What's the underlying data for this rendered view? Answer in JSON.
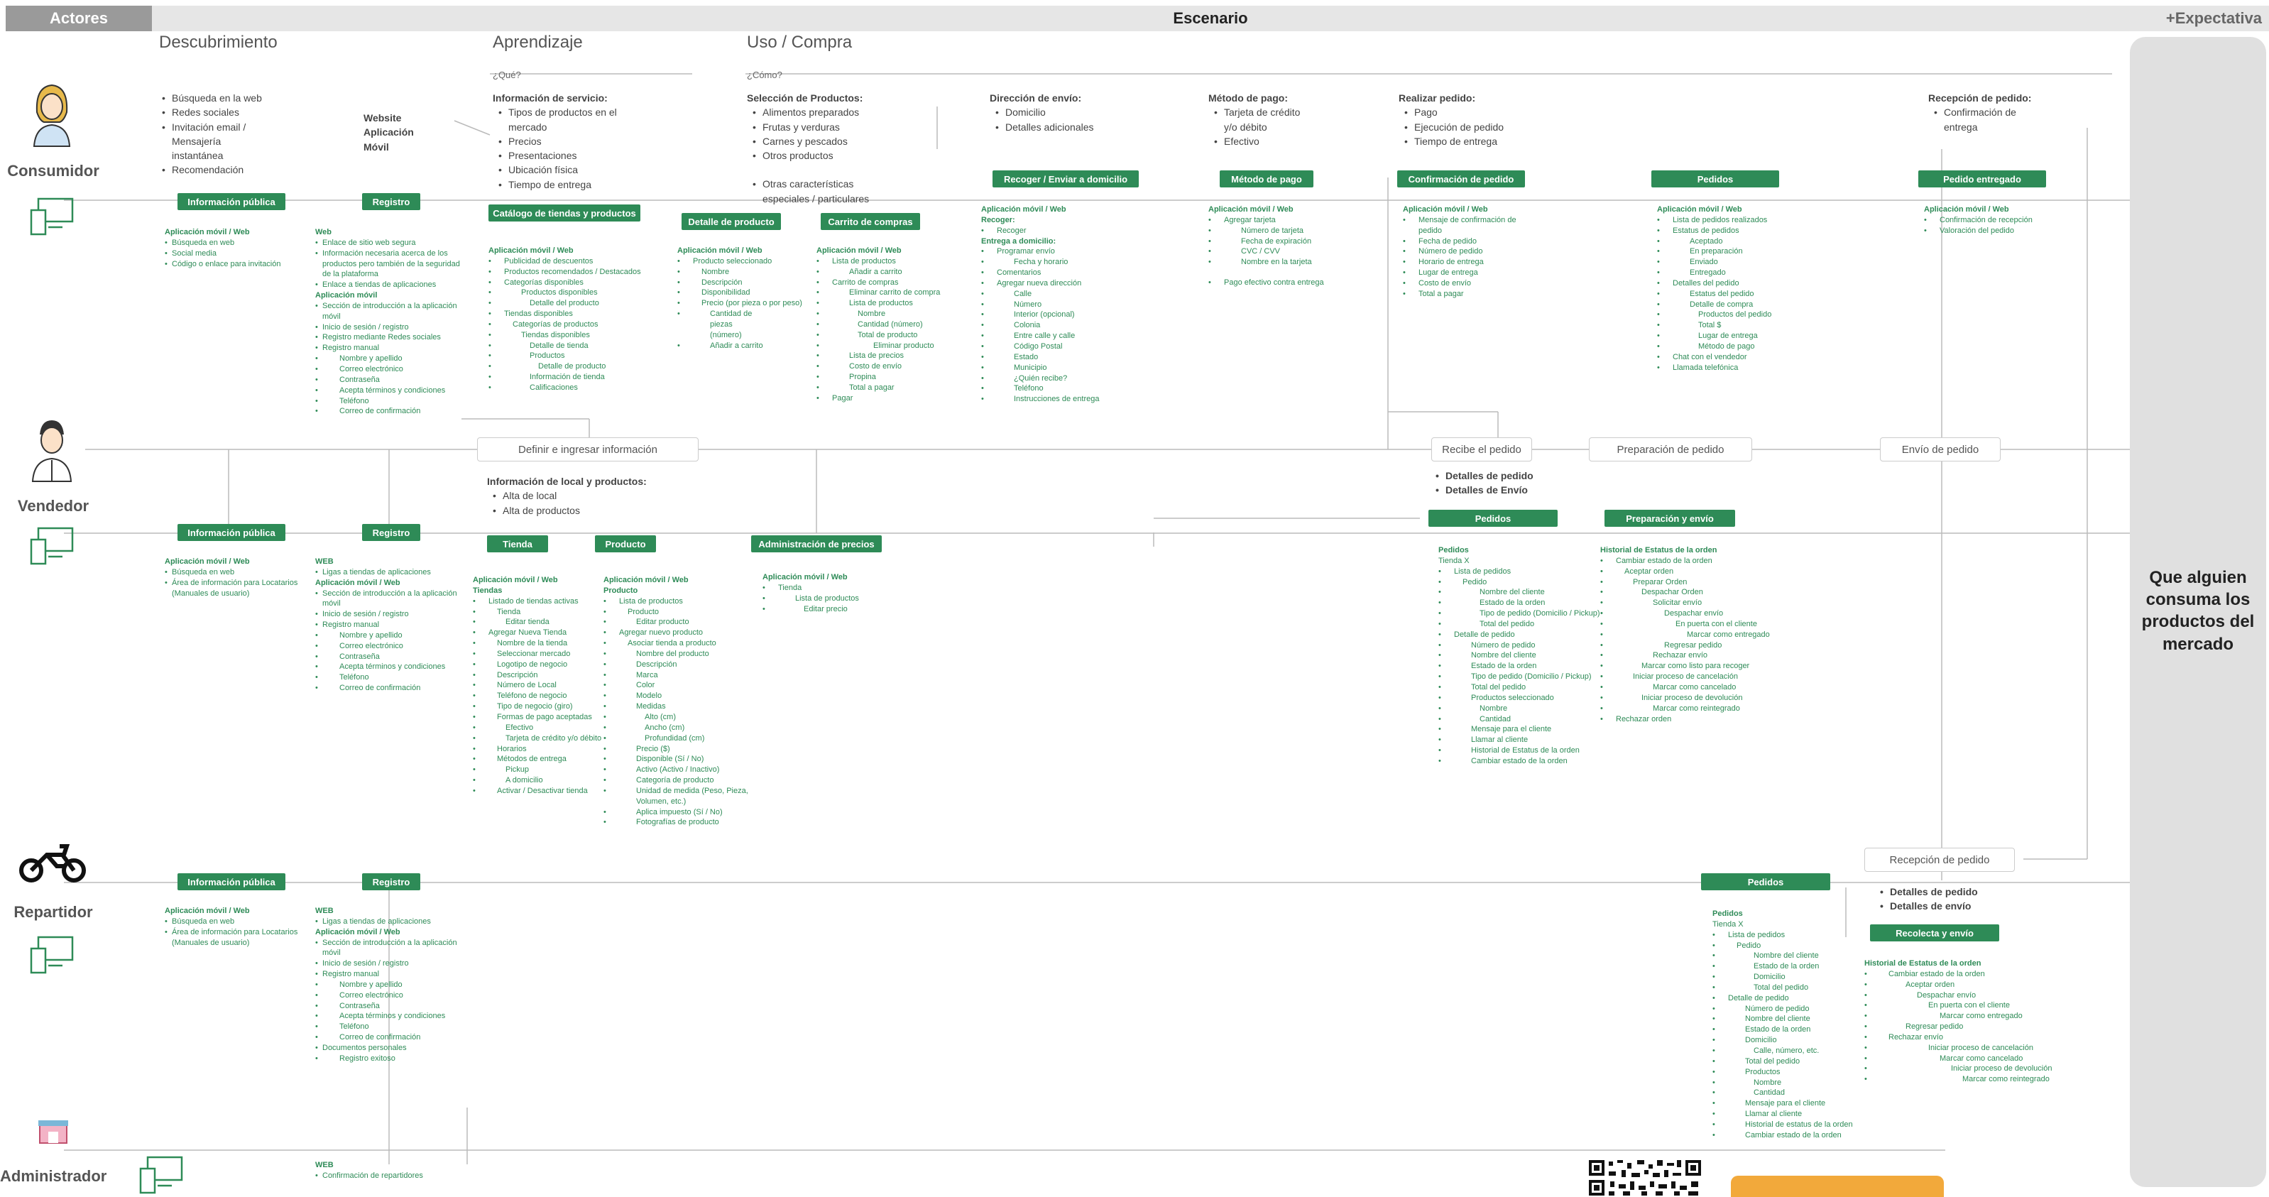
{
  "header": {
    "actors": "Actores",
    "scenario": "Escenario",
    "expectation": "+Expectativa"
  },
  "phases": {
    "discovery": "Descubrimiento",
    "learning": "Aprendizaje",
    "use": "Uso / Compra",
    "what": "¿Qué?",
    "how": "¿Cómo?"
  },
  "actors": {
    "consumer": "Consumidor",
    "seller": "Vendedor",
    "courier": "Repartidor",
    "admin": "Administrador"
  },
  "consumer": {
    "discovery_list": [
      "Búsqueda en la web",
      "Redes sociales",
      "Invitación email / Mensajería instantánea",
      "Recomendación"
    ],
    "channel": "Website Aplicación Móvil",
    "service_info": {
      "title": "Información de servicio:",
      "items": [
        "Tipos de productos en el mercado",
        "Precios",
        "Presentaciones",
        "Ubicación física",
        "Tiempo de entrega"
      ]
    },
    "product_selection": {
      "title": "Selección de Productos:",
      "items": [
        "Alimentos preparados",
        "Frutas y verduras",
        "Carnes y pescados",
        "Otros productos"
      ],
      "extra": "Otras características especiales / particulares"
    },
    "address": {
      "title": "Dirección de envío:",
      "items": [
        "Domicilio",
        "Detalles adicionales"
      ]
    },
    "payment": {
      "title": "Método de pago:",
      "items": [
        "Tarjeta de crédito y/o débito",
        "Efectivo"
      ]
    },
    "order": {
      "title": "Realizar pedido:",
      "items": [
        "Pago",
        "Ejecución de pedido",
        "Tiempo de entrega"
      ]
    },
    "reception": {
      "title": "Recepción de pedido:",
      "items": [
        "Confirmación de entrega"
      ]
    },
    "buttons": {
      "public_info": "Información pública",
      "register": "Registro",
      "catalog": "Catálogo de tiendas y productos",
      "product_detail": "Detalle de producto",
      "cart": "Carrito de compras",
      "pickup": "Recoger / Enviar a domicilio",
      "payment_method": "Método de pago",
      "order_confirm": "Confirmación de pedido",
      "orders": "Pedidos",
      "delivered": "Pedido entregado"
    },
    "notes": {
      "public_info": [
        "Aplicación móvil / Web",
        "Búsqueda en web",
        "Social media",
        "Código o enlace para invitación"
      ],
      "register": [
        "Web",
        "Enlace de sitio web segura",
        "Información necesaria acerca de los productos pero también de la seguridad de la plataforma",
        "Enlace a tiendas de aplicaciones",
        "Aplicación móvil",
        "Sección de introducción a la aplicación móvil",
        "Inicio de sesión / registro",
        "Registro mediante Redes sociales",
        "Registro manual",
        "Nombre y apellido",
        "Correo electrónico",
        "Contraseña",
        "Acepta términos y condiciones",
        "Teléfono",
        "Correo de confirmación"
      ],
      "catalog": [
        "Aplicación móvil / Web",
        "Publicidad de descuentos",
        "Productos recomendados / Destacados",
        "Categorías disponibles",
        "Productos disponibles",
        "Detalle del producto",
        "Tiendas disponibles",
        "Categorías de productos",
        "Tiendas disponibles",
        "Detalle de tienda",
        "Productos",
        "Detalle de producto",
        "Información de tienda",
        "Calificaciones"
      ],
      "product_detail": [
        "Aplicación móvil / Web",
        "Producto seleccionado",
        "Nombre",
        "Descripción",
        "Disponibilidad",
        "Precio (por pieza o por peso)",
        "Cantidad de piezas (número)",
        "Añadir a carrito"
      ],
      "cart": [
        "Aplicación móvil / Web",
        "Lista de productos",
        "Añadir a carrito",
        "Carrito de compras",
        "Eliminar carrito de compra",
        "Lista de productos",
        "Nombre",
        "Cantidad (número)",
        "Total de producto",
        "Eliminar producto",
        "Lista de precios",
        "Costo de envío",
        "Propina",
        "Total a pagar",
        "Pagar"
      ],
      "pickup": [
        "Aplicación móvil / Web",
        "Recoger:",
        "Recoger",
        "Entrega a domicilio:",
        "Programar envío",
        "Fecha y horario",
        "Comentarios",
        "Agregar nueva dirección",
        "Calle",
        "Número",
        "Interior (opcional)",
        "Colonia",
        "Entre calle y calle",
        "Código Postal",
        "Estado",
        "Municipio",
        "¿Quién recibe?",
        "Teléfono",
        "Instrucciones de entrega"
      ],
      "payment_method": [
        "Aplicación móvil / Web",
        "Agregar tarjeta",
        "Número de tarjeta",
        "Fecha de expiración",
        "CVC / CVV",
        "Nombre en la tarjeta",
        "Pago efectivo contra entrega"
      ],
      "order_confirm": [
        "Aplicación móvil / Web",
        "Mensaje de confirmación de pedido",
        "Fecha de pedido",
        "Número de pedido",
        "Horario de entrega",
        "Lugar de entrega",
        "Costo de envío",
        "Total a pagar"
      ],
      "orders": [
        "Aplicación móvil / Web",
        "Lista de pedidos realizados",
        "Estatus de pedidos",
        "Aceptado",
        "En preparación",
        "Enviado",
        "Entregado",
        "Detalles del pedido",
        "Estatus del pedido",
        "Detalle de compra",
        "Productos del pedido",
        "Total $",
        "Lugar de entrega",
        "Método de pago",
        "Chat con el vendedor",
        "Llamada telefónica"
      ],
      "delivered": [
        "Aplicación móvil / Web",
        "Confirmación de recepción",
        "Valoración del pedido"
      ]
    }
  },
  "seller": {
    "define_box": "Definir e ingresar  información",
    "receive_box": "Recibe el pedido",
    "prep_box": "Preparación de pedido",
    "ship_box": "Envío de pedido",
    "local_info": {
      "title": "Información de local y productos:",
      "items": [
        "Alta de local",
        "Alta de productos"
      ]
    },
    "order_details": [
      "Detalles de pedido",
      "Detalles de Envío"
    ],
    "buttons": {
      "public_info": "Información pública",
      "register": "Registro",
      "store": "Tienda",
      "product": "Producto",
      "prices": "Administración de precios",
      "orders": "Pedidos",
      "prep_ship": "Preparación y envío"
    },
    "notes": {
      "public_info": [
        "Aplicación móvil / Web",
        "Búsqueda en web",
        "Área de información para Locatarios (Manuales de usuario)"
      ],
      "register": [
        "WEB",
        "Ligas a tiendas de aplicaciones",
        "Aplicación móvil / Web",
        "Sección de introducción a la aplicación móvil",
        "Inicio de sesión / registro",
        "Registro manual",
        "Nombre y apellido",
        "Correo electrónico",
        "Contraseña",
        "Acepta términos y condiciones",
        "Teléfono",
        "Correo de confirmación"
      ],
      "store": [
        "Aplicación móvil / Web",
        "Tiendas",
        "Listado de tiendas activas",
        "Tienda",
        "Editar tienda",
        "Agregar Nueva Tienda",
        "Nombre de la tienda",
        "Seleccionar mercado",
        "Logotipo de negocio",
        "Descripción",
        "Número de Local",
        "Teléfono de negocio",
        "Tipo de negocio (giro)",
        "Formas de pago aceptadas",
        "Efectivo",
        "Tarjeta de crédito y/o débito",
        "Horarios",
        "Métodos de entrega",
        "Pickup",
        "A domicilio",
        "Activar / Desactivar tienda"
      ],
      "product": [
        "Aplicación móvil / Web",
        "Producto",
        "Lista de productos",
        "Producto",
        "Editar producto",
        "Agregar nuevo producto",
        "Asociar tienda a producto",
        "Nombre del producto",
        "Descripción",
        "Marca",
        "Color",
        "Modelo",
        "Medidas",
        "Alto (cm)",
        "Ancho (cm)",
        "Profundidad (cm)",
        "Precio ($)",
        "Disponible (Sí / No)",
        "Activo (Activo / Inactivo)",
        "Categoría de producto",
        "Unidad de medida (Peso, Pieza, Volumen, etc.)",
        "Aplica impuesto (Sí / No)",
        "Fotografías de producto"
      ],
      "prices": [
        "Aplicación móvil / Web",
        "Tienda",
        "Lista de productos",
        "Editar precio"
      ],
      "orders": [
        "Pedidos",
        "Tienda X",
        "Lista de pedidos",
        "Pedido",
        "Nombre del cliente",
        "Estado de la orden",
        "Tipo de pedido (Domicilio / Pickup)",
        "Total del pedido",
        "Detalle de pedido",
        "Número de pedido",
        "Nombre del cliente",
        "Estado de la orden",
        "Tipo de pedido (Domicilio / Pickup)",
        "Total del pedido",
        "Productos seleccionado",
        "Nombre",
        "Cantidad",
        "Mensaje para el cliente",
        "Llamar al cliente",
        "Historial de Estatus de la orden",
        "Cambiar estado de la orden"
      ],
      "prep_ship": [
        "Historial de Estatus de la orden",
        "Cambiar estado de la orden",
        "Aceptar orden",
        "Preparar Orden",
        "Despachar Orden",
        "Solicitar envío",
        "Despachar envío",
        "En puerta con el cliente",
        "Marcar como entregado",
        "Regresar pedido",
        "Rechazar envío",
        "Marcar como listo para recoger",
        "Iniciar proceso de cancelación",
        "Marcar como cancelado",
        "Iniciar proceso de devolución",
        "Marcar como reintegrado",
        "Rechazar orden"
      ]
    }
  },
  "courier": {
    "receive_box": "Recepción de pedido",
    "order_details": [
      "Detalles de pedido",
      "Detalles de envío"
    ],
    "buttons": {
      "public_info": "Información pública",
      "register": "Registro",
      "orders": "Pedidos",
      "pickup_ship": "Recolecta y envío"
    },
    "notes": {
      "public_info": [
        "Aplicación móvil / Web",
        "Búsqueda en web",
        "Área de información para Locatarios (Manuales de usuario)"
      ],
      "register": [
        "WEB",
        "Ligas a tiendas de aplicaciones",
        "Aplicación móvil / Web",
        "Sección de introducción a la aplicación móvil",
        "Inicio de sesión / registro",
        "Registro manual",
        "Nombre y apellido",
        "Correo electrónico",
        "Contraseña",
        "Acepta términos y condiciones",
        "Teléfono",
        "Correo de confirmación",
        "Documentos personales",
        "Registro exitoso"
      ],
      "orders": [
        "Pedidos",
        "Tienda X",
        "Lista de pedidos",
        "Pedido",
        "Nombre del cliente",
        "Estado de la orden",
        "Domicilio",
        "Total del pedido",
        "Detalle de pedido",
        "Número de pedido",
        "Nombre del cliente",
        "Estado de la orden",
        "Domicilio",
        "Calle, número, etc.",
        "Total del pedido",
        "Productos",
        "Nombre",
        "Cantidad",
        "Mensaje para el cliente",
        "Llamar al cliente",
        "Historial de estatus de la orden",
        "Cambiar estado de la orden"
      ],
      "pickup_ship": [
        "Historial de Estatus de la orden",
        "Cambiar estado de la orden",
        "Aceptar orden",
        "Despachar envío",
        "En puerta con el cliente",
        "Marcar como entregado",
        "Regresar pedido",
        "Rechazar envío",
        "Iniciar proceso de cancelación",
        "Marcar como cancelado",
        "Iniciar proceso de devolución",
        "Marcar como reintegrado"
      ]
    }
  },
  "admin": {
    "notes": {
      "register": [
        "WEB",
        "Confirmación de repartidores"
      ]
    }
  },
  "expectation_text": "Que alguien consuma los productos del mercado",
  "colors": {
    "accent": "#2e8b57",
    "header": "#e6e6e6",
    "actors_header": "#9a9a9a",
    "orange": "#f2a93b"
  }
}
